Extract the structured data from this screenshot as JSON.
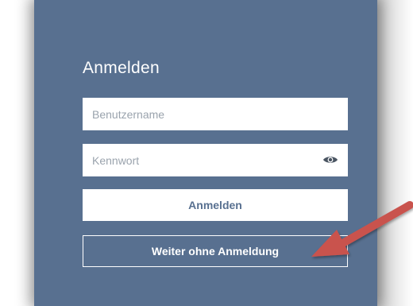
{
  "login": {
    "title": "Anmelden",
    "username_placeholder": "Benutzername",
    "password_placeholder": "Kennwort",
    "submit_label": "Anmelden",
    "guest_label": "Weiter ohne Anmeldung"
  },
  "colors": {
    "panel_bg": "#587090",
    "field_bg": "#ffffff",
    "primary_text": "#587090",
    "annotation_arrow": "#c9534e"
  },
  "icons": {
    "password_toggle": "eye-icon",
    "annotation": "red-arrow-annotation"
  }
}
